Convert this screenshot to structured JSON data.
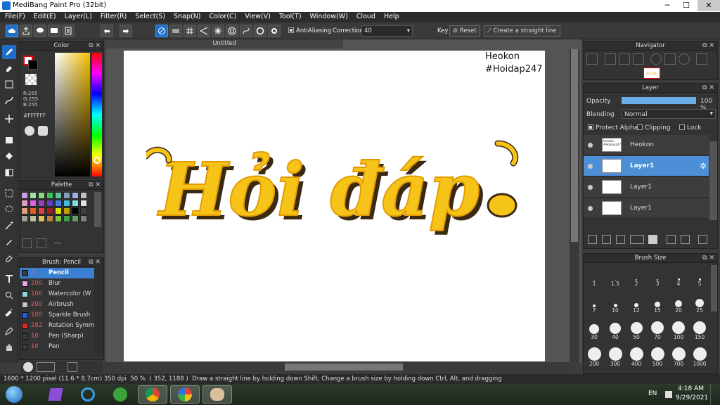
{
  "app": {
    "title": "MediBang Paint Pro (32bit)"
  },
  "window_controls": {
    "minimize": "─",
    "maximize": "☐",
    "close": "✕"
  },
  "menu": [
    "File(F)",
    "Edit(E)",
    "Layer(L)",
    "Filter(R)",
    "Select(S)",
    "Snap(N)",
    "Color(C)",
    "View(V)",
    "Tool(T)",
    "Window(W)",
    "Cloud",
    "Help"
  ],
  "toolbar": {
    "antialiasing_label": "AntiAliasing",
    "correction_label": "Correction",
    "correction_value": "40",
    "key_label": "Key",
    "reset_label": "Reset",
    "straight_line_label": "Create a straight line"
  },
  "color_panel": {
    "title": "Color",
    "r": "R:255",
    "g": "G:255",
    "b": "B:255",
    "hex": "#FFFFFF"
  },
  "palette_panel": {
    "title": "Palette",
    "name": "---",
    "swatches": [
      "#c8a0e0",
      "#a0e0a0",
      "#80e080",
      "#40c060",
      "#60c0a0",
      "#80a0c0",
      "#a0b0e0",
      "#c0c0c0",
      "#e0a0c0",
      "#e060e0",
      "#a040c0",
      "#6040c0",
      "#4080e0",
      "#40c0e0",
      "#80e0e0",
      "#e0e0e0",
      "#e0a080",
      "#e06020",
      "#e04040",
      "#a02020",
      "#e0e000",
      "#c0a000",
      "#000000",
      "#404040",
      "#a0a0a0",
      "#c0c0a0",
      "#e0c060",
      "#c08040",
      "#80c040",
      "#40a040",
      "#60a060",
      "#808080"
    ]
  },
  "brush_panel": {
    "title": "Brush: Pencil",
    "brushes": [
      {
        "size": "4",
        "name": "Pencil",
        "color": "#3a3a3a"
      },
      {
        "size": "200",
        "name": "Blur",
        "color": "#e6a6e6"
      },
      {
        "size": "100",
        "name": "Watercolor (W",
        "color": "#8fd6e6"
      },
      {
        "size": "200",
        "name": "Airbrush",
        "color": "#c8c8c8"
      },
      {
        "size": "100",
        "name": "Sparkle Brush",
        "color": "#2b58d6"
      },
      {
        "size": "282",
        "name": "Rotation Symm",
        "color": "#d62b2b"
      },
      {
        "size": "10",
        "name": "Pen (Sharp)",
        "color": "#3a3a3a"
      },
      {
        "size": "10",
        "name": "Pen",
        "color": "#3a3a3a"
      }
    ]
  },
  "document": {
    "tab": "Untitled",
    "text_line1": "Heokon",
    "text_line2": "#Hoidap247",
    "art_text": "Hỏi đáp"
  },
  "navigator": {
    "title": "Navigator",
    "thumb_text": "Hỏi đáp"
  },
  "layer_panel": {
    "title": "Layer",
    "opacity_label": "Opacity",
    "opacity_value": "100 %",
    "opacity_fraction": 1.0,
    "blending_label": "Blending",
    "blending_value": "Normal",
    "protect_alpha": "Protect Alpha",
    "clipping": "Clipping",
    "lock": "Lock",
    "layers": [
      {
        "name": "Heokon",
        "thumb": "Heokon #Hoidap247"
      },
      {
        "name": "Layer1",
        "selected": true
      },
      {
        "name": "Layer1"
      },
      {
        "name": "Layer1"
      }
    ]
  },
  "brush_size": {
    "title": "Brush Size",
    "sizes": [
      "1",
      "1.5",
      "2",
      "3",
      "4",
      "5",
      "7",
      "10",
      "12",
      "15",
      "20",
      "25",
      "30",
      "40",
      "50",
      "70",
      "100",
      "150",
      "200",
      "300",
      "400",
      "500",
      "700",
      "1000"
    ]
  },
  "status": {
    "dimensions": "1600 * 1200 pixel",
    "physical": "(11.6 * 8.7cm)",
    "dpi": "350 dpi",
    "zoom": "50 %",
    "coords": "( 352, 1188 )",
    "hint": "Draw a straight line by holding down Shift, Change a brush size by holding down Ctrl, Alt, and dragging"
  },
  "taskbar": {
    "lang": "EN",
    "time": "4:18 AM",
    "date": "9/29/2021"
  }
}
